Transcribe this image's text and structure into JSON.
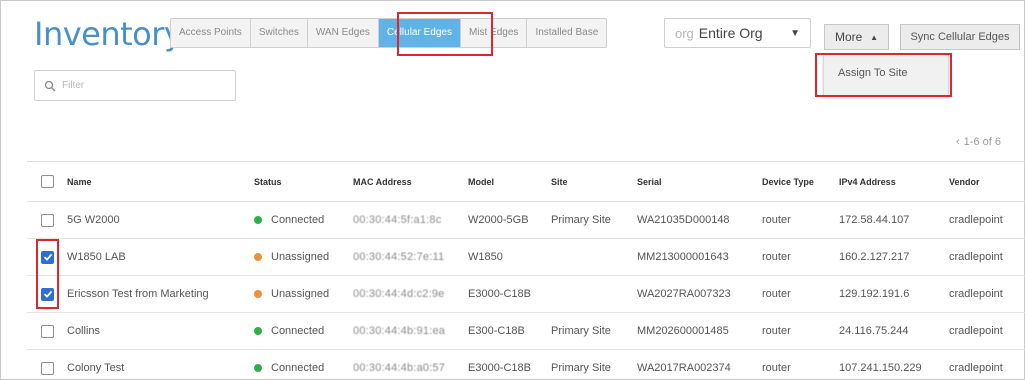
{
  "page": {
    "title": "Inventory",
    "tabs": [
      {
        "label": "Access Points",
        "active": false
      },
      {
        "label": "Switches",
        "active": false
      },
      {
        "label": "WAN Edges",
        "active": false
      },
      {
        "label": "Cellular Edges",
        "active": true
      },
      {
        "label": "Mist Edges",
        "active": false
      },
      {
        "label": "Installed Base",
        "active": false
      }
    ],
    "org_select": {
      "prefix": "org",
      "value": "Entire Org"
    },
    "more_label": "More",
    "sync_label": "Sync Cellular Edges",
    "dropdown": {
      "items": [
        "Assign To Site"
      ]
    },
    "filter": {
      "placeholder": "Filter",
      "value": ""
    },
    "pager": {
      "prev_icon": "chevron-left-icon",
      "text": "1-6 of 6"
    }
  },
  "colors": {
    "accent": "#4a90c8",
    "active_tab": "#5fb3e6",
    "connected": "#2bb04a",
    "unassigned": "#f0903a",
    "highlight": "#d9282f",
    "checkbox_checked": "#2f6fd3"
  },
  "table": {
    "columns": [
      "Name",
      "Status",
      "MAC Address",
      "Model",
      "Site",
      "Serial",
      "Device Type",
      "IPv4 Address",
      "Vendor"
    ],
    "rows": [
      {
        "checked": false,
        "name": "5G W2000",
        "status": "Connected",
        "status_color": "#2bb04a",
        "mac": "00:30:44:5f:a1:8c",
        "model": "W2000-5GB",
        "site": "Primary Site",
        "serial": "WA21035D000148",
        "device_type": "router",
        "ip": "172.58.44.107",
        "vendor": "cradlepoint"
      },
      {
        "checked": true,
        "name": "W1850 LAB",
        "status": "Unassigned",
        "status_color": "#f0903a",
        "mac": "00:30:44:52:7e:11",
        "model": "W1850",
        "site": "",
        "serial": "MM213000001643",
        "device_type": "router",
        "ip": "160.2.127.217",
        "vendor": "cradlepoint"
      },
      {
        "checked": true,
        "name": "Ericsson Test from Marketing",
        "status": "Unassigned",
        "status_color": "#f0903a",
        "mac": "00:30:44:4d:c2:9e",
        "model": "E3000-C18B",
        "site": "",
        "serial": "WA2027RA007323",
        "device_type": "router",
        "ip": "129.192.191.6",
        "vendor": "cradlepoint"
      },
      {
        "checked": false,
        "name": "Collins",
        "status": "Connected",
        "status_color": "#2bb04a",
        "mac": "00:30:44:4b:91:ea",
        "model": "E300-C18B",
        "site": "Primary Site",
        "serial": "MM202600001485",
        "device_type": "router",
        "ip": "24.116.75.244",
        "vendor": "cradlepoint"
      },
      {
        "checked": false,
        "name": "Colony Test",
        "status": "Connected",
        "status_color": "#2bb04a",
        "mac": "00:30:44:4b:a0:57",
        "model": "E3000-C18B",
        "site": "Primary Site",
        "serial": "WA2017RA002374",
        "device_type": "router",
        "ip": "107.241.150.229",
        "vendor": "cradlepoint"
      }
    ]
  }
}
